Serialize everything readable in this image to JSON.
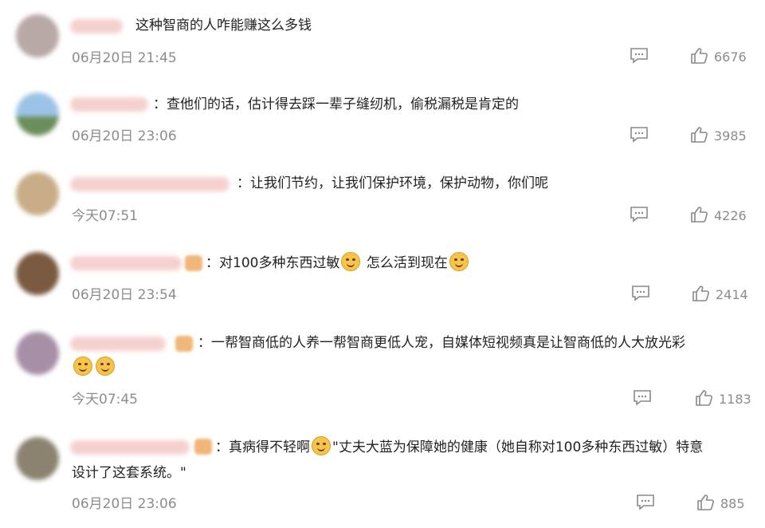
{
  "comments": [
    {
      "text": "这种智商的人咋能赚这么多钱",
      "time": "06月20日 21:45",
      "likes": "6676"
    },
    {
      "text": "：查他们的话，估计得去踩一辈子缝纫机，偷税漏税是肯定的",
      "time": "06月20日 23:06",
      "likes": "3985"
    },
    {
      "text": "：让我们节约，让我们保护环境，保护动物，你们呢",
      "time": "今天07:51",
      "likes": "4226"
    },
    {
      "text_a": "：对100多种东西过敏",
      "text_b": "怎么活到现在",
      "time": "06月20日 23:54",
      "likes": "2414"
    },
    {
      "text": "：一帮智商低的人养一帮智商更低人宠，自媒体短视频真是让智商低的人大放光彩",
      "time": "今天07:45",
      "likes": "1183"
    },
    {
      "text_a": "：真病得不轻啊",
      "text_b": "\"丈夫大蓝为保障她的健康（她自称对100多种东西过敏）特意",
      "text_line2": "设计了这套系统。\"",
      "time": "06月20日 23:06",
      "likes": "885"
    }
  ],
  "icons": {
    "reply": "comment-bubble-icon",
    "like": "thumbs-up-icon"
  }
}
